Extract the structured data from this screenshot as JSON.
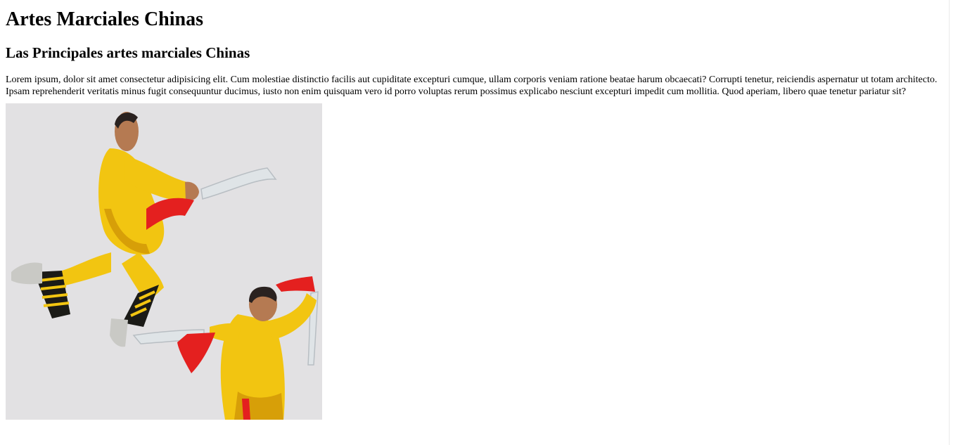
{
  "page": {
    "title": "Artes Marciales Chinas",
    "subtitle": "Las Principales artes marciales Chinas",
    "paragraph": "Lorem ipsum, dolor sit amet consectetur adipisicing elit. Cum molestiae distinctio facilis aut cupiditate excepturi cumque, ullam corporis veniam ratione beatae harum obcaecati? Corrupti tenetur, reiciendis aspernatur ut totam architecto. Ipsam reprehenderit veritatis minus fugit consequuntur ducimus, iusto non enim quisquam vero id porro voluptas rerum possimus explicabo nesciunt excepturi impedit cum mollitia. Quod aperiam, libero quae tenetur pariatur sit?"
  },
  "image": {
    "subject": "two-martial-artists-with-swords",
    "colors": {
      "background": "#e2e1e3",
      "uniform": "#f2c511",
      "uniform_shadow": "#d79f08",
      "sash": "#e4201f",
      "skin": "#b57a52",
      "blade": "#dfe4e7",
      "leg_wrap": "#1b1b17"
    }
  }
}
